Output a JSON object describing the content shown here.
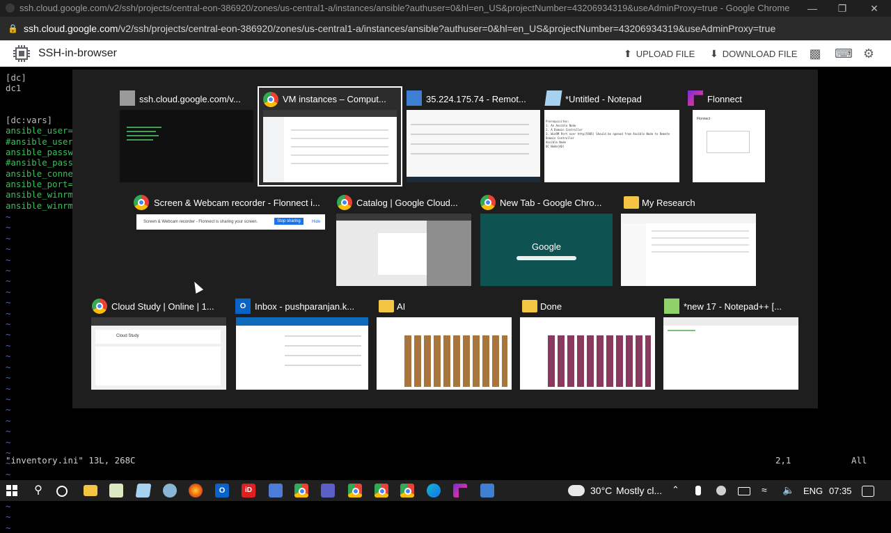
{
  "window": {
    "title": "ssh.cloud.google.com/v2/ssh/projects/central-eon-386920/zones/us-central1-a/instances/ansible?authuser=0&hl=en_US&projectNumber=43206934319&useAdminProxy=true - Google Chrome",
    "url_host": "ssh.cloud.google.com",
    "url_path": "/v2/ssh/projects/central-eon-386920/zones/us-central1-a/instances/ansible?authuser=0&hl=en_US&projectNumber=43206934319&useAdminProxy=true"
  },
  "ssh_header": {
    "app_name": "SSH-in-browser",
    "upload_label": "UPLOAD FILE",
    "download_label": "DOWNLOAD FILE"
  },
  "terminal": {
    "lines": [
      "[dc]",
      "dc1",
      "",
      "[dc:vars]",
      "ansible_user=win\\theid",
      "#ansible_user=win\\admin",
      "ansible_password=Sup",
      "#ansible_password=Sec",
      "ansible_connection=wi",
      "ansible_port=",
      "ansible_winrm_server_cert_validation=ignore",
      "ansible_winrm_transport="
    ],
    "status_file": "\"inventory.ini\" 13L, 268C",
    "status_pos": "2,1",
    "status_view": "All"
  },
  "switcher": {
    "tiles": [
      {
        "title": "ssh.cloud.google.com/v...",
        "icon": "terminal-icon"
      },
      {
        "title": "VM instances – Comput...",
        "icon": "chrome-icon"
      },
      {
        "title": "35.224.175.74 - Remot...",
        "icon": "remote-desktop-icon"
      },
      {
        "title": "*Untitled - Notepad",
        "icon": "notepad-icon"
      },
      {
        "title": "Flonnect",
        "icon": "flonnect-icon"
      },
      {
        "title": "Screen & Webcam recorder - Flonnect i...",
        "icon": "chrome-icon"
      },
      {
        "title": "Catalog | Google Cloud...",
        "icon": "chrome-icon"
      },
      {
        "title": "New Tab - Google Chro...",
        "icon": "chrome-icon"
      },
      {
        "title": "My Research",
        "icon": "folder-icon"
      },
      {
        "title": "Cloud Study | Online | 1...",
        "icon": "chrome-icon"
      },
      {
        "title": "Inbox - pushparanjan.k...",
        "icon": "outlook-icon"
      },
      {
        "title": "AI",
        "icon": "folder-icon"
      },
      {
        "title": "Done",
        "icon": "folder-icon"
      },
      {
        "title": "*new 17 - Notepad++ [...",
        "icon": "notepadpp-icon"
      }
    ],
    "notepad_thumb_lines": [
      "Prerequisites:",
      "1. An Ansible Node",
      "2. A Domain Controller",
      "3. WinRM Port over http(5985) Should be opened from Ansible Node to Remote Domain Controller",
      "Ansible Node",
      "DC Node(AD)"
    ],
    "recorder_text": "Screen & Webcam recorder - Flonnect is sharing your screen.",
    "recorder_stop": "Stop sharing",
    "recorder_hide": "Hide",
    "newtab_logo": "Google",
    "flonnect_thumb": "Flonnect",
    "cloudstudy_thumb": "Cloud Study"
  },
  "taskbar": {
    "temperature": "30°C",
    "weather": "Mostly cl...",
    "language": "ENG",
    "time": "07:35"
  }
}
